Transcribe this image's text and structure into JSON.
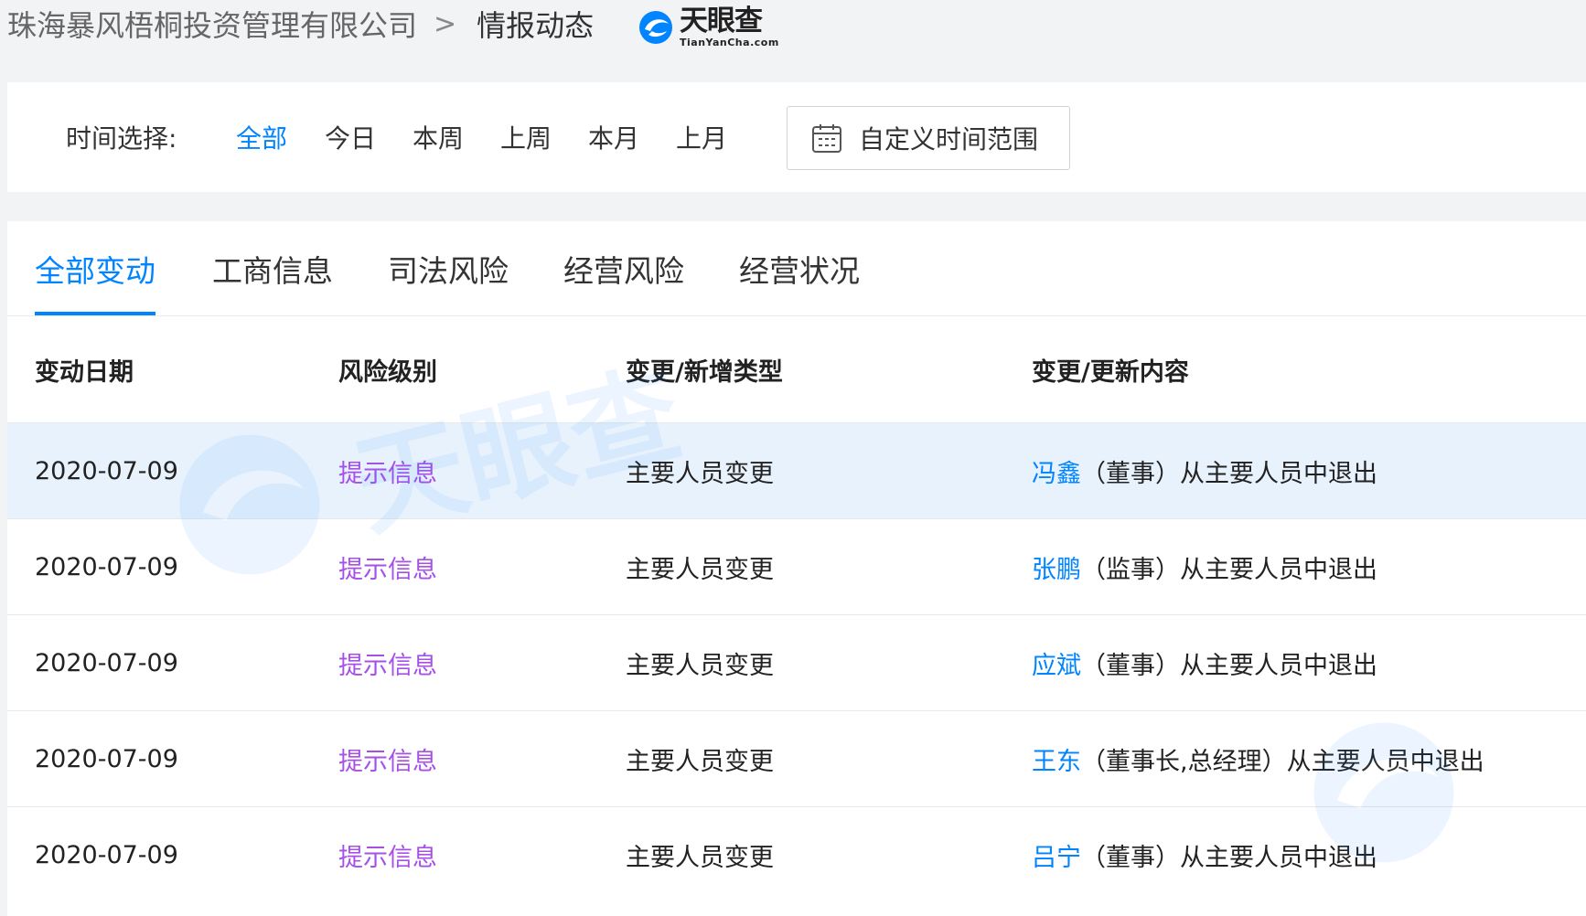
{
  "breadcrumb": {
    "company": "珠海暴风梧桐投资管理有限公司",
    "separator": ">",
    "current": "情报动态"
  },
  "logo": {
    "cn": "天眼查",
    "en": "TianYanCha.com",
    "icon": "tianyancha-logo-icon"
  },
  "filter": {
    "label": "时间选择:",
    "options": [
      "全部",
      "今日",
      "本周",
      "上周",
      "本月",
      "上月"
    ],
    "active": "全部",
    "custom_range": "自定义时间范围",
    "custom_icon": "calendar-icon"
  },
  "tabs": {
    "items": [
      "全部变动",
      "工商信息",
      "司法风险",
      "经营风险",
      "经营状况"
    ],
    "active": "全部变动"
  },
  "table": {
    "columns": [
      "变动日期",
      "风险级别",
      "变更/新增类型",
      "变更/更新内容"
    ],
    "rows": [
      {
        "date": "2020-07-09",
        "risk": "提示信息",
        "type": "主要人员变更",
        "person": "冯鑫",
        "content": "（董事）从主要人员中退出"
      },
      {
        "date": "2020-07-09",
        "risk": "提示信息",
        "type": "主要人员变更",
        "person": "张鹏",
        "content": "（监事）从主要人员中退出"
      },
      {
        "date": "2020-07-09",
        "risk": "提示信息",
        "type": "主要人员变更",
        "person": "应斌",
        "content": "（董事）从主要人员中退出"
      },
      {
        "date": "2020-07-09",
        "risk": "提示信息",
        "type": "主要人员变更",
        "person": "王东",
        "content": "（董事长,总经理）从主要人员中退出"
      },
      {
        "date": "2020-07-09",
        "risk": "提示信息",
        "type": "主要人员变更",
        "person": "吕宁",
        "content": "（董事）从主要人员中退出"
      }
    ]
  },
  "colors": {
    "accent": "#0084ff",
    "risk": "#a650e8",
    "highlight_row": "#e8f2fd",
    "page_bg": "#f2f3f5"
  }
}
